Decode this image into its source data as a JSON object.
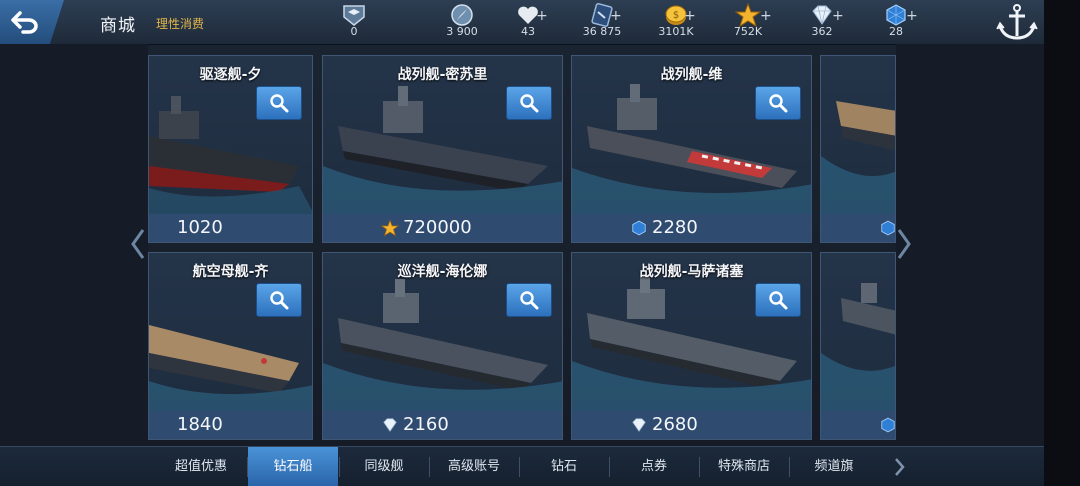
{
  "header": {
    "title": "商城",
    "subtitle": "理性消费",
    "resources": [
      {
        "icon": "rank-badge-icon",
        "value": "0",
        "has_plus": false
      },
      {
        "icon": "compass-icon",
        "value": "3 900",
        "has_plus": false
      },
      {
        "icon": "heart-icon",
        "value": "43",
        "has_plus": true
      },
      {
        "icon": "ticket-icon",
        "value": "36 875",
        "has_plus": true
      },
      {
        "icon": "gold-coin-icon",
        "value": "3101K",
        "has_plus": true
      },
      {
        "icon": "star-icon",
        "value": "752K",
        "has_plus": true
      },
      {
        "icon": "diamond-icon",
        "value": "362",
        "has_plus": true
      },
      {
        "icon": "blue-gem-icon",
        "value": "28",
        "has_plus": true
      }
    ]
  },
  "ships": [
    {
      "name": "驱逐舰-夕",
      "price": "1020",
      "currency": ""
    },
    {
      "name": "战列舰-密苏里",
      "price": "720000",
      "currency": "star-icon"
    },
    {
      "name": "战列舰-维",
      "price": "2280",
      "currency": "blue-gem-icon"
    },
    {
      "name": "航空母舰-齐",
      "price": "1840",
      "currency": ""
    },
    {
      "name": "巡洋舰-海伦娜",
      "price": "2160",
      "currency": "diamond-icon"
    },
    {
      "name": "战列舰-马萨诸塞",
      "price": "2680",
      "currency": "diamond-icon"
    }
  ],
  "tabs": [
    {
      "label": "超值优惠",
      "active": false
    },
    {
      "label": "钻石船",
      "active": true
    },
    {
      "label": "同级舰",
      "active": false
    },
    {
      "label": "高级账号",
      "active": false
    },
    {
      "label": "钻石",
      "active": false
    },
    {
      "label": "点券",
      "active": false
    },
    {
      "label": "特殊商店",
      "active": false
    },
    {
      "label": "频道旗",
      "active": false
    }
  ],
  "colors": {
    "accent_blue": "#2d71bd",
    "gold": "#e1b64b",
    "card_bg": "#23364d",
    "price_bar": "#2f4c70"
  }
}
